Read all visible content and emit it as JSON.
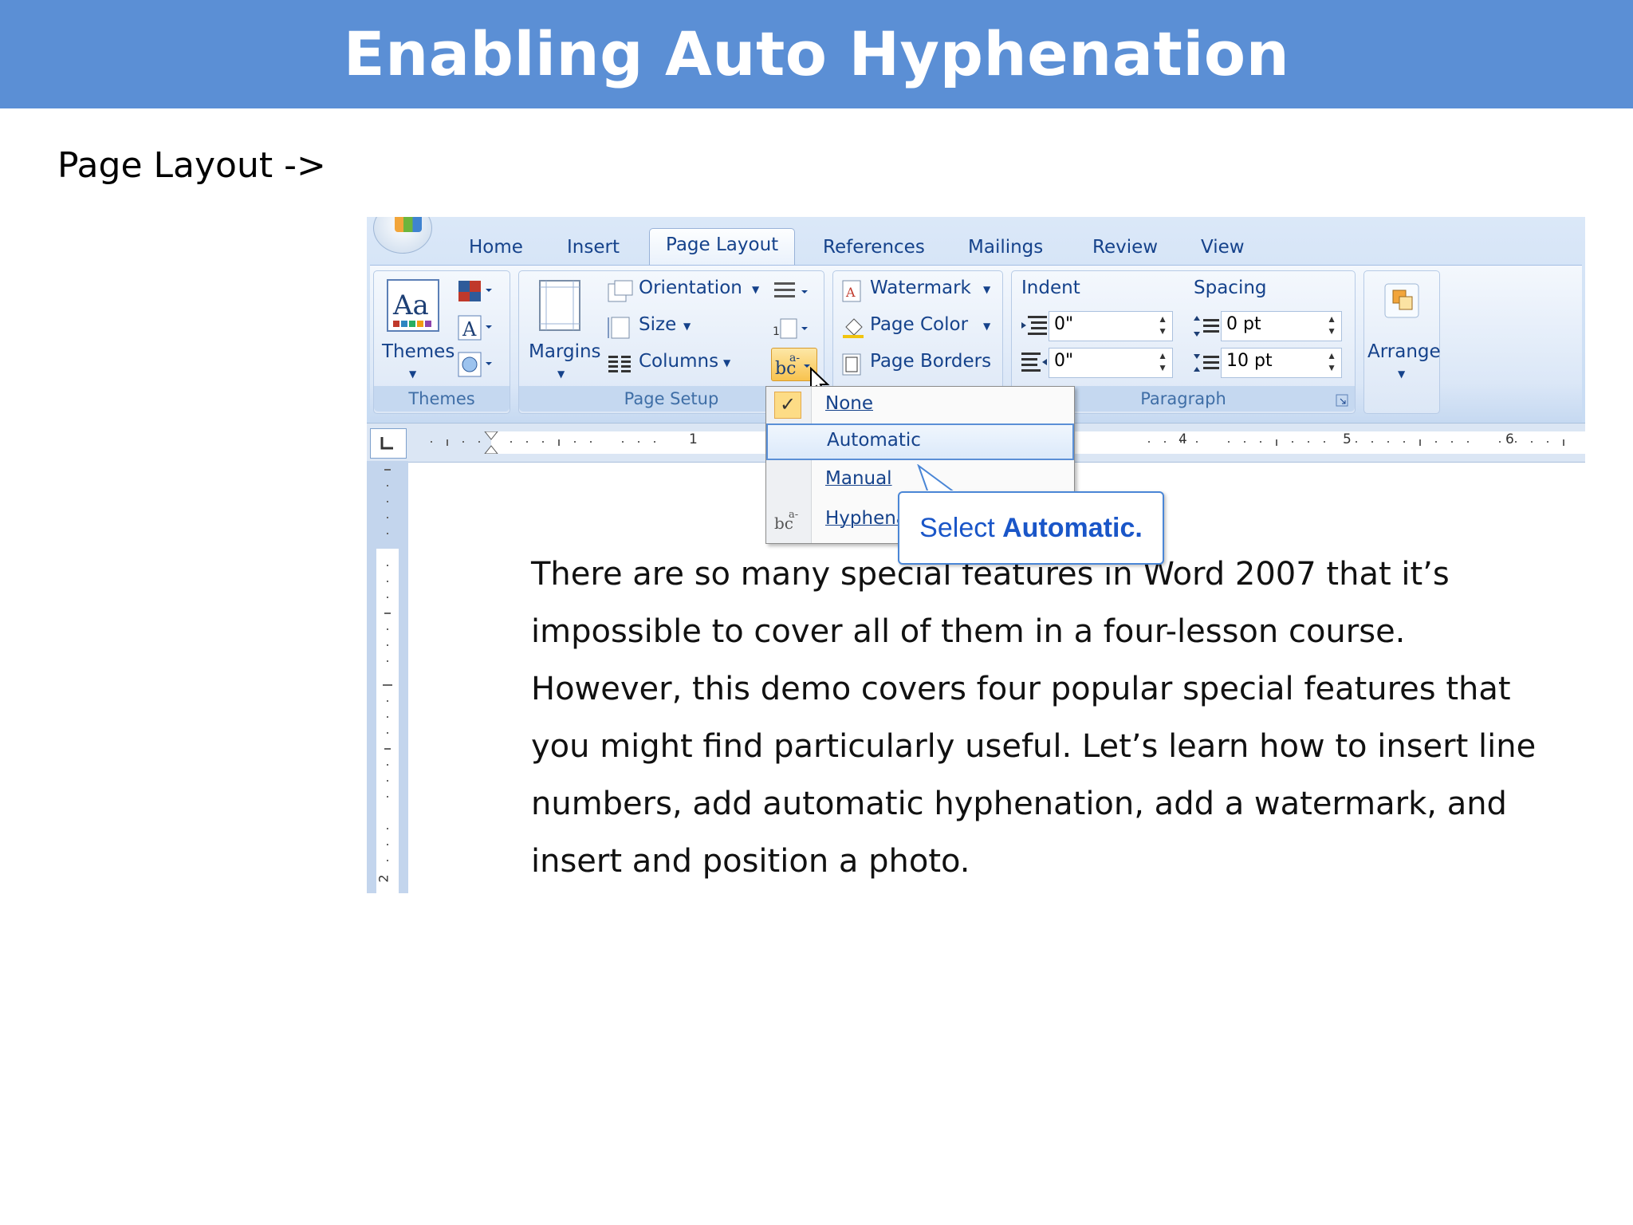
{
  "slide": {
    "title": "Enabling Auto Hyphenation",
    "subtitle": "Page Layout ->"
  },
  "ribbon": {
    "tabs": [
      "Home",
      "Insert",
      "Page Layout",
      "References",
      "Mailings",
      "Review",
      "View"
    ],
    "active_tab": "Page Layout",
    "themes_group": {
      "label": "Themes",
      "button": "Themes"
    },
    "page_setup_group": {
      "label": "Page Setup",
      "margins": "Margins",
      "orientation": "Orientation",
      "size": "Size",
      "columns": "Columns"
    },
    "page_background": {
      "watermark": "Watermark",
      "page_color": "Page Color",
      "page_borders": "Page Borders"
    },
    "paragraph_group": {
      "label": "Paragraph",
      "indent_label": "Indent",
      "spacing_label": "Spacing",
      "indent_left": "0\"",
      "indent_right": "0\"",
      "spacing_before": "0 pt",
      "spacing_after": "10 pt"
    },
    "arrange": "Arrange"
  },
  "ruler": {
    "numbers": [
      "1",
      "4",
      "5",
      "6"
    ],
    "vertical_number": "2"
  },
  "hyphenation_menu": {
    "items": [
      {
        "label": "None",
        "checked": true
      },
      {
        "label": "Automatic",
        "highlighted": true
      },
      {
        "label": "Manual"
      },
      {
        "label": "Hyphena"
      }
    ]
  },
  "callout": {
    "prefix": "Select ",
    "bold": "Automatic."
  },
  "document": {
    "lines": [
      "There are so many special features in Word 2007 that it’s",
      "impossible to cover all of them in a four-lesson course.",
      "However, this demo covers four popular special features that",
      "you might find particularly useful. Let’s learn how to insert line",
      "numbers, add automatic hyphenation, add a watermark, and",
      "insert and position a photo."
    ]
  },
  "colors": {
    "title_bar": "#5b8fd5",
    "ribbon_text": "#15428b",
    "callout_text": "#1a56c8",
    "menu_highlight_border": "#5a8fd6"
  }
}
